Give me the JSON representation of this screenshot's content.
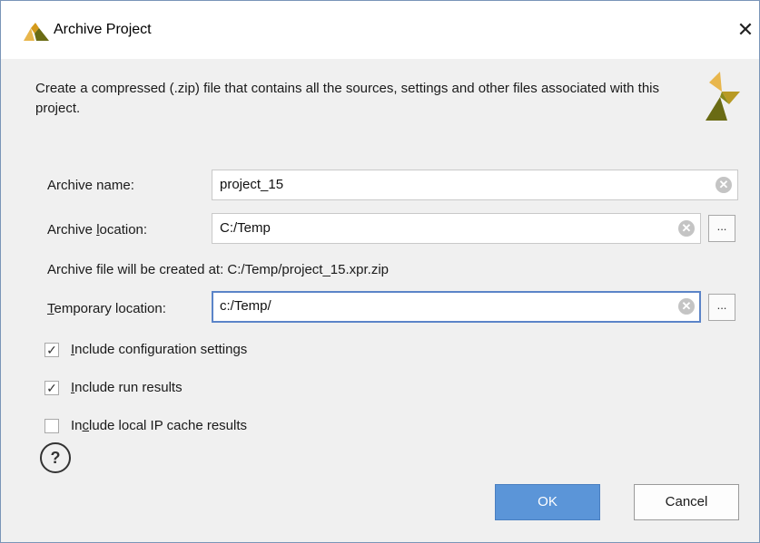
{
  "window": {
    "title": "Archive Project",
    "close_glyph": "✕"
  },
  "description": "Create a compressed (.zip) file that contains all the sources, settings and other files associated with this project.",
  "archive_name": {
    "label": "Archive name:",
    "value": "project_15"
  },
  "archive_location": {
    "label_before": "Archive ",
    "label_mnemonic": "l",
    "label_after": "ocation:",
    "value": "C:/Temp"
  },
  "archive_info": "Archive file will be created at: C:/Temp/project_15.xpr.zip",
  "temporary_location": {
    "label_mnemonic": "T",
    "label_after": "emporary location:",
    "value": "c:/Temp/"
  },
  "options": [
    {
      "mnemonic": "I",
      "rest": "nclude configuration settings",
      "checked": true
    },
    {
      "mnemonic": "I",
      "rest": "nclude run results",
      "checked": true
    },
    {
      "prefix": "In",
      "mnemonic": "c",
      "rest": "lude local IP cache results",
      "checked": false
    }
  ],
  "buttons": {
    "ok": "OK",
    "cancel": "Cancel",
    "help": "?",
    "browse": "..."
  },
  "icons": {
    "title_logo": "xilinx-logo-icon",
    "header_logo": "xilinx-logo-icon",
    "clear": "clear-circle-icon",
    "check": "checkmark-icon"
  },
  "colors": {
    "accent": "#5b95d8",
    "logo_light": "#e8b64c",
    "logo_dark": "#6a6b14",
    "focus_border": "#5b84c8"
  }
}
